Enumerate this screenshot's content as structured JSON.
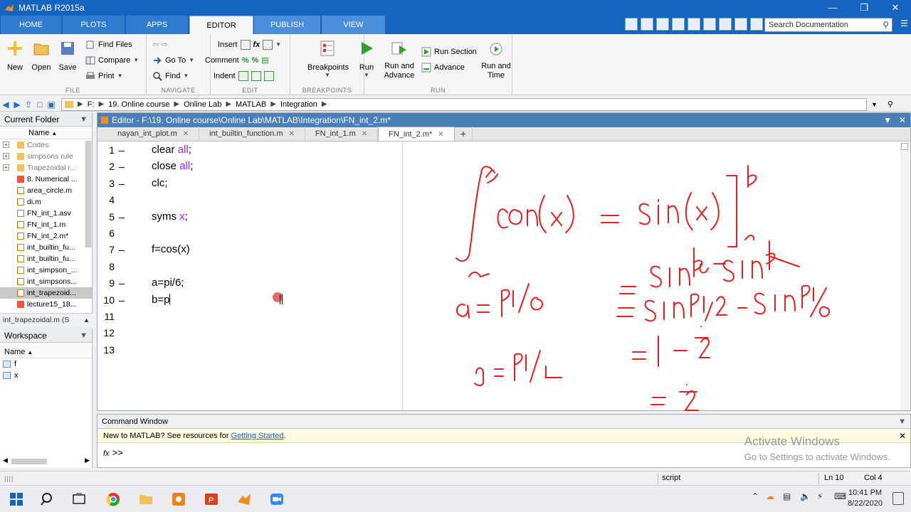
{
  "window": {
    "title": "MATLAB R2015a"
  },
  "ribbon_tabs": [
    "HOME",
    "PLOTS",
    "APPS",
    "EDITOR",
    "PUBLISH",
    "VIEW"
  ],
  "search": {
    "placeholder": "Search Documentation"
  },
  "ribbon": {
    "file": {
      "label": "FILE",
      "new": "New",
      "open": "Open",
      "save": "Save",
      "find_files": "Find Files",
      "compare": "Compare",
      "print": "Print"
    },
    "navigate": {
      "label": "NAVIGATE",
      "goto": "Go To",
      "find": "Find"
    },
    "edit": {
      "label": "EDIT",
      "insert": "Insert",
      "comment": "Comment",
      "indent": "Indent"
    },
    "breakpoints": {
      "label": "BREAKPOINTS",
      "breakpoints": "Breakpoints"
    },
    "run": {
      "label": "RUN",
      "run": "Run",
      "run_and_advance": "Run and Advance",
      "run_section": "Run Section",
      "advance": "Advance",
      "run_and_time": "Run and Time"
    }
  },
  "address": {
    "crumbs": [
      "F:",
      "19. Online course",
      "Online Lab",
      "MATLAB",
      "Integration"
    ]
  },
  "current_folder": {
    "title": "Current Folder",
    "column": "Name",
    "items": [
      {
        "name": "Codes",
        "type": "folder"
      },
      {
        "name": "simpsons rule",
        "type": "folder"
      },
      {
        "name": "Trapezoidal r...",
        "type": "folder"
      },
      {
        "name": "8. Numerical ...",
        "type": "file"
      },
      {
        "name": "area_circle.m",
        "type": "file"
      },
      {
        "name": "di.m",
        "type": "file"
      },
      {
        "name": "FN_int_1.asv",
        "type": "file"
      },
      {
        "name": "FN_int_1.m",
        "type": "file"
      },
      {
        "name": "FN_int_2.m*",
        "type": "file"
      },
      {
        "name": "int_builtin_fu...",
        "type": "file"
      },
      {
        "name": "int_builtin_fu...",
        "type": "file"
      },
      {
        "name": "int_simpson_...",
        "type": "file"
      },
      {
        "name": "int_simpsons...",
        "type": "file"
      },
      {
        "name": "int_trapezoid...",
        "type": "file"
      },
      {
        "name": "lecture15_18...",
        "type": "file"
      }
    ],
    "details": "int_trapezoidal.m  (S"
  },
  "workspace": {
    "title": "Workspace",
    "column": "Name",
    "items": [
      "f",
      "x"
    ]
  },
  "editor": {
    "title": "Editor - F:\\19. Online course\\Online Lab\\MATLAB\\Integration\\FN_int_2.m*",
    "tabs": [
      "nayan_int_plot.m",
      "int_builtin_function.m",
      "FN_int_1.m",
      "FN_int_2.m*"
    ],
    "lines": [
      {
        "n": "1",
        "text": "clear ",
        "kw": "all",
        "tail": ";"
      },
      {
        "n": "2",
        "text": "close ",
        "kw": "all",
        "tail": ";"
      },
      {
        "n": "3",
        "text": "clc;",
        "kw": "",
        "tail": ""
      },
      {
        "n": "4",
        "text": "",
        "kw": "",
        "tail": ""
      },
      {
        "n": "5",
        "text": "syms ",
        "kw": "x",
        "tail": ";"
      },
      {
        "n": "6",
        "text": "",
        "kw": "",
        "tail": ""
      },
      {
        "n": "7",
        "text": "f=cos(x)",
        "kw": "",
        "tail": ""
      },
      {
        "n": "8",
        "text": "",
        "kw": "",
        "tail": ""
      },
      {
        "n": "9",
        "text": "a=pi/6;",
        "kw": "",
        "tail": ""
      },
      {
        "n": "10",
        "text": "b=p",
        "kw": "",
        "tail": ""
      },
      {
        "n": "11",
        "text": "",
        "kw": "",
        "tail": ""
      },
      {
        "n": "12",
        "text": "",
        "kw": "",
        "tail": ""
      },
      {
        "n": "13",
        "text": "",
        "kw": "",
        "tail": ""
      }
    ]
  },
  "command_window": {
    "title": "Command Window",
    "notice_prefix": "New to MATLAB? See resources for ",
    "notice_link": "Getting Started",
    "notice_suffix": ".",
    "prompt": ">>",
    "fx": "fx"
  },
  "watermark": {
    "line1": "Activate Windows",
    "line2": "Go to Settings to activate Windows."
  },
  "status": {
    "mode": "script",
    "ln": "Ln  10",
    "col": "Col  4"
  },
  "taskbar": {
    "time": "10:41 PM",
    "date": "8/22/2020"
  },
  "colors": {
    "accent": "#1565c0",
    "annotation": "#e02020",
    "keyword": "#a020f0"
  }
}
